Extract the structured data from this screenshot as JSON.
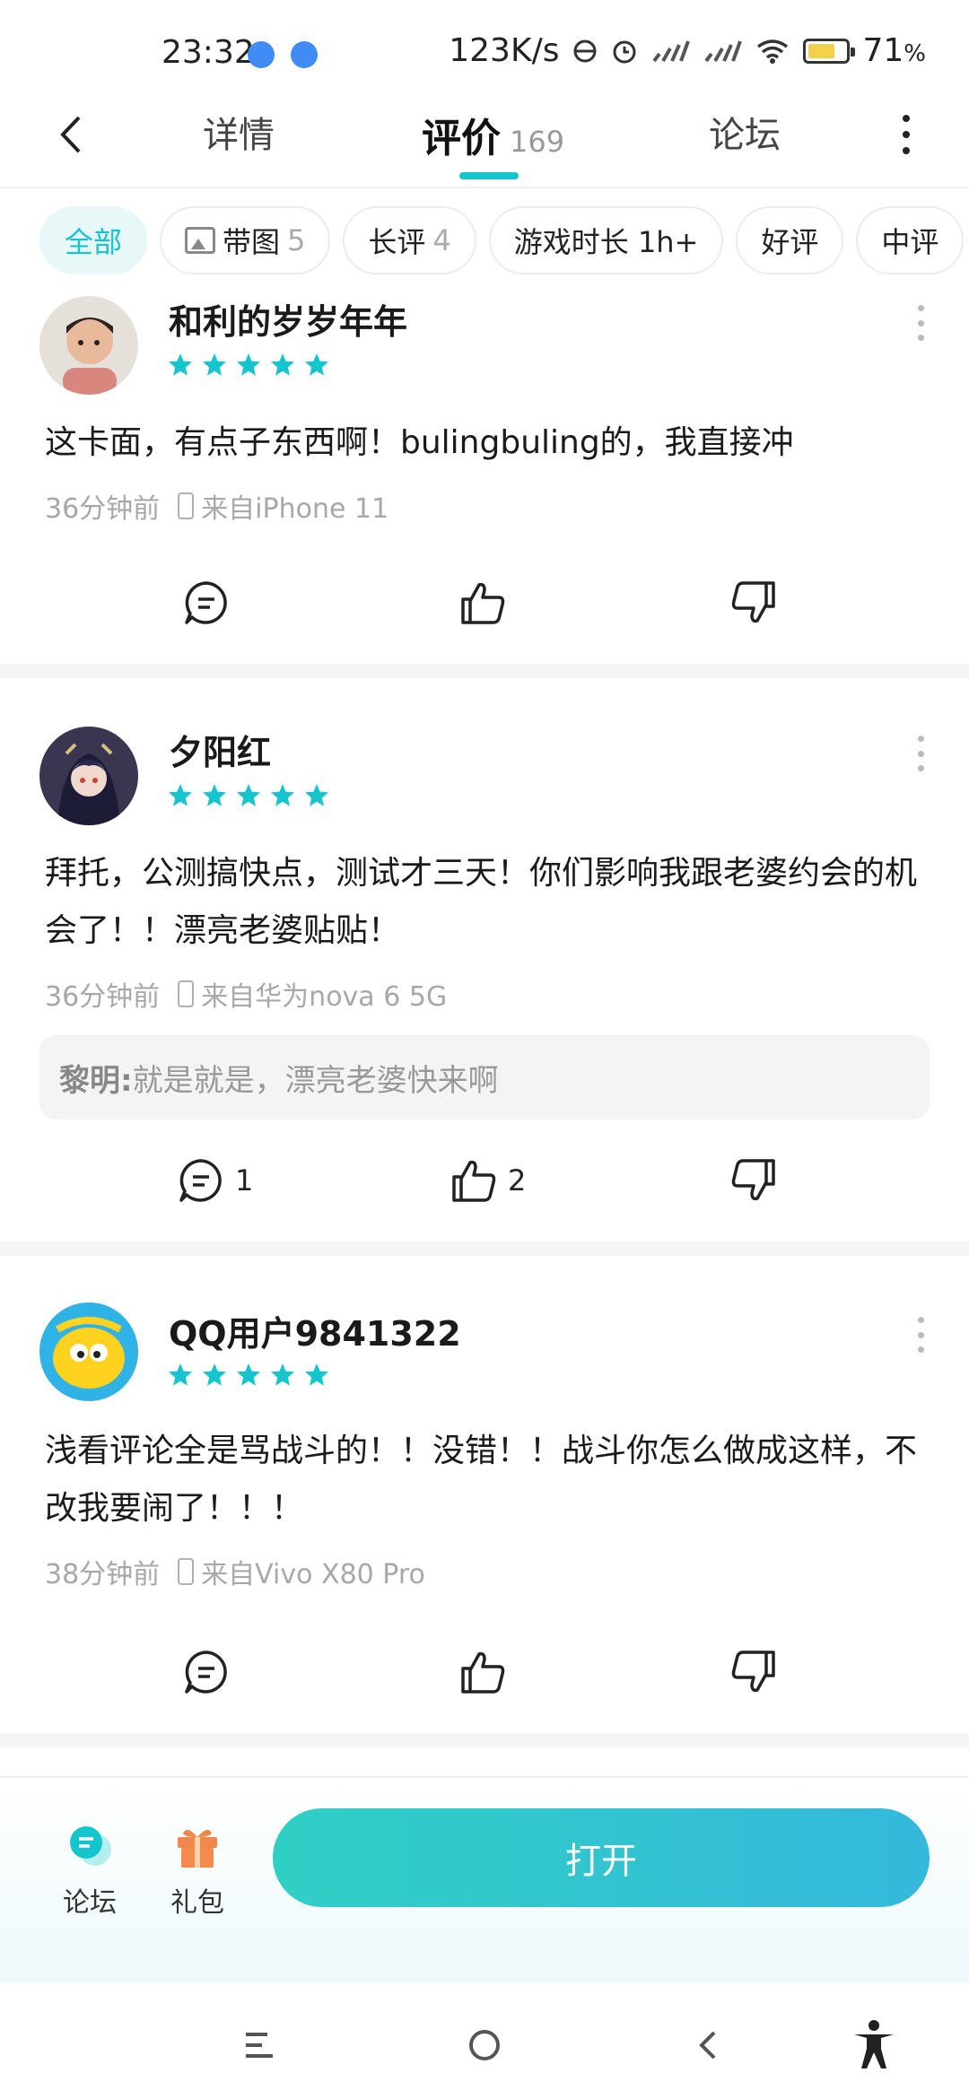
{
  "status_bar": {
    "time": "23:32",
    "network_speed": "123K/s",
    "battery_percent": "71",
    "battery_unit": "%"
  },
  "nav": {
    "tabs": [
      {
        "label": "详情"
      },
      {
        "label": "评价",
        "count": "169"
      },
      {
        "label": "论坛"
      }
    ],
    "accent_color": "#15c5ce"
  },
  "filters": [
    {
      "label": "全部"
    },
    {
      "label": "带图",
      "count": "5"
    },
    {
      "label": "长评",
      "count": "4"
    },
    {
      "label": "游戏时长 1h+"
    },
    {
      "label": "好评"
    },
    {
      "label": "中评"
    }
  ],
  "reviews": [
    {
      "username": "和利的岁岁年年",
      "rating": 5,
      "content": "这卡面，有点子东西啊！bulingbuling的，我直接冲",
      "time": "36分钟前",
      "device": "来自iPhone 11",
      "reply": null,
      "comments": "",
      "likes": ""
    },
    {
      "username": "夕阳红",
      "rating": 5,
      "content": "拜托，公测搞快点，测试才三天！你们影响我跟老婆约会的机会了！！漂亮老婆贴贴！",
      "time": "36分钟前",
      "device": "来自华为nova 6 5G",
      "reply": {
        "author": "黎明:",
        "text": "就是就是，漂亮老婆快来啊"
      },
      "comments": "1",
      "likes": "2"
    },
    {
      "username": "QQ用户9841322",
      "rating": 5,
      "content": "浅看评论全是骂战斗的！！没错！！战斗你怎么做成这样，不改我要闹了！！！",
      "time": "38分钟前",
      "device": "来自Vivo X80 Pro",
      "reply": null,
      "comments": "",
      "likes": ""
    }
  ],
  "bottom_bar": {
    "forum_label": "论坛",
    "gift_label": "礼包",
    "open_label": "打开"
  },
  "icons": {
    "back": "chevron-left-icon",
    "more": "more-vertical-icon",
    "comment": "comment-icon",
    "like": "thumb-up-icon",
    "dislike": "thumb-down-icon",
    "forum": "chat-bubble-icon",
    "gift": "gift-icon",
    "menu": "menu-icon",
    "home": "home-circle-icon",
    "nav_back": "nav-back-icon",
    "accessibility": "accessibility-icon"
  }
}
